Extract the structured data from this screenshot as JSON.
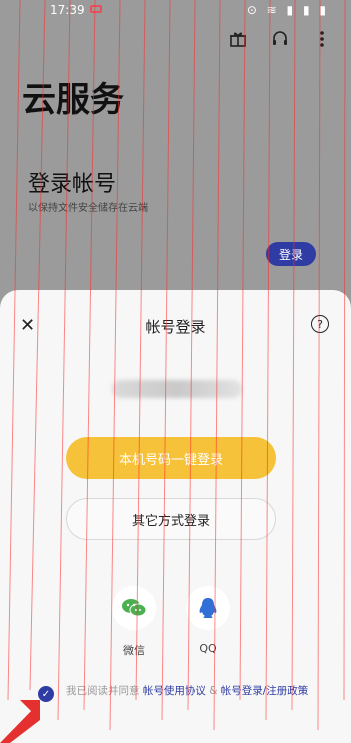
{
  "status_bar": {
    "time": "17:39",
    "indicators": "⊙ ≋ ▮ ▮ ▮"
  },
  "header": {
    "app_title": "云服务"
  },
  "account": {
    "title": "登录帐号",
    "subtitle": "以保持文件安全储存在云端",
    "login_button": "登录"
  },
  "sheet": {
    "title": "帐号登录",
    "masked_number": "",
    "primary_button": "本机号码一键登录",
    "secondary_button": "其它方式登录",
    "social": [
      {
        "label": "微信",
        "icon": "wechat-icon",
        "color": "#4caf50"
      },
      {
        "label": "QQ",
        "icon": "qq-icon",
        "color": "#2f6fd6"
      }
    ],
    "agreement": {
      "prefix": "我已阅读并同意",
      "link1": "帐号使用协议",
      "and": "&",
      "link2": "帐号登录/注册政策"
    }
  },
  "colors": {
    "primary": "#f5c23a",
    "accent": "#2f3ca3"
  }
}
